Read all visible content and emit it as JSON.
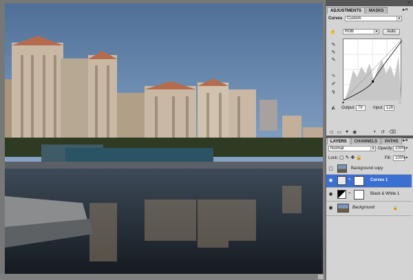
{
  "adjustments": {
    "tabs": [
      {
        "label": "ADJUSTMENTS",
        "active": true
      },
      {
        "label": "MASKS",
        "active": false
      }
    ],
    "type_label": "Curves",
    "preset_value": "Custom",
    "channel_value": "RGB",
    "auto_label": "Auto",
    "output_label": "Output:",
    "output_value": "79",
    "input_label": "Input:",
    "input_value": "128",
    "curve_point": {
      "input": 128,
      "output": 79
    }
  },
  "layers_panel": {
    "tabs": [
      {
        "label": "LAYERS",
        "active": true
      },
      {
        "label": "CHANNELS",
        "active": false
      },
      {
        "label": "PATHS",
        "active": false
      }
    ],
    "blend_mode": "Normal",
    "opacity_label": "Opacity:",
    "opacity_value": "100%",
    "lock_label": "Lock:",
    "fill_label": "Fill:",
    "fill_value": "100%",
    "layers": [
      {
        "name": "Background copy",
        "visible": false,
        "selected": false
      },
      {
        "name": "Curves 1",
        "visible": true,
        "selected": true
      },
      {
        "name": "Black & White 1",
        "visible": true,
        "selected": false
      },
      {
        "name": "Background",
        "visible": true,
        "selected": false
      }
    ]
  },
  "icons": {
    "panel_menu": "panel-menu-icon",
    "eyedropper": "eyedropper-icon",
    "eye": "eye-icon",
    "lock": "lock-icon",
    "link": "link-icon"
  },
  "colors": {
    "panel_bg": "#d4d4d4",
    "selection": "#3b6fd1",
    "sky": "#6a8db6"
  }
}
